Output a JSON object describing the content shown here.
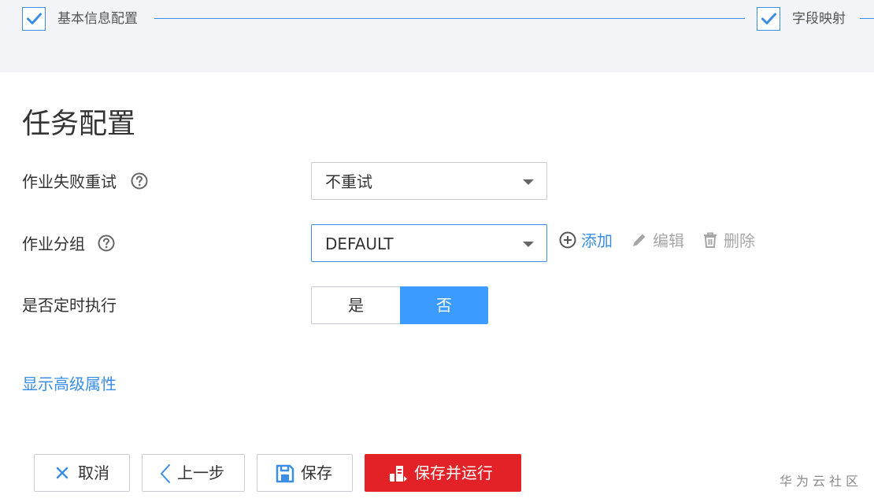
{
  "stepper": {
    "steps": [
      {
        "label": "基本信息配置",
        "status": "completed"
      },
      {
        "label": "字段映射",
        "status": "completed"
      }
    ],
    "accent_color": "#3a8ee6"
  },
  "section": {
    "title": "任务配置"
  },
  "form": {
    "retry": {
      "label": "作业失败重试",
      "value": "不重试",
      "icon": "help-circle-icon"
    },
    "group": {
      "label": "作业分组",
      "value": "DEFAULT",
      "icon": "help-circle-icon",
      "actions": {
        "add": "添加",
        "edit": "编辑",
        "delete": "删除"
      }
    },
    "schedule": {
      "label": "是否定时执行",
      "options": [
        "是",
        "否"
      ],
      "selected": "否"
    }
  },
  "advanced_link": "显示高级属性",
  "footer": {
    "cancel": "取消",
    "prev": "上一步",
    "save": "保存",
    "save_run": "保存并运行",
    "primary_color": "#e32227"
  },
  "watermark": "华为云社区"
}
